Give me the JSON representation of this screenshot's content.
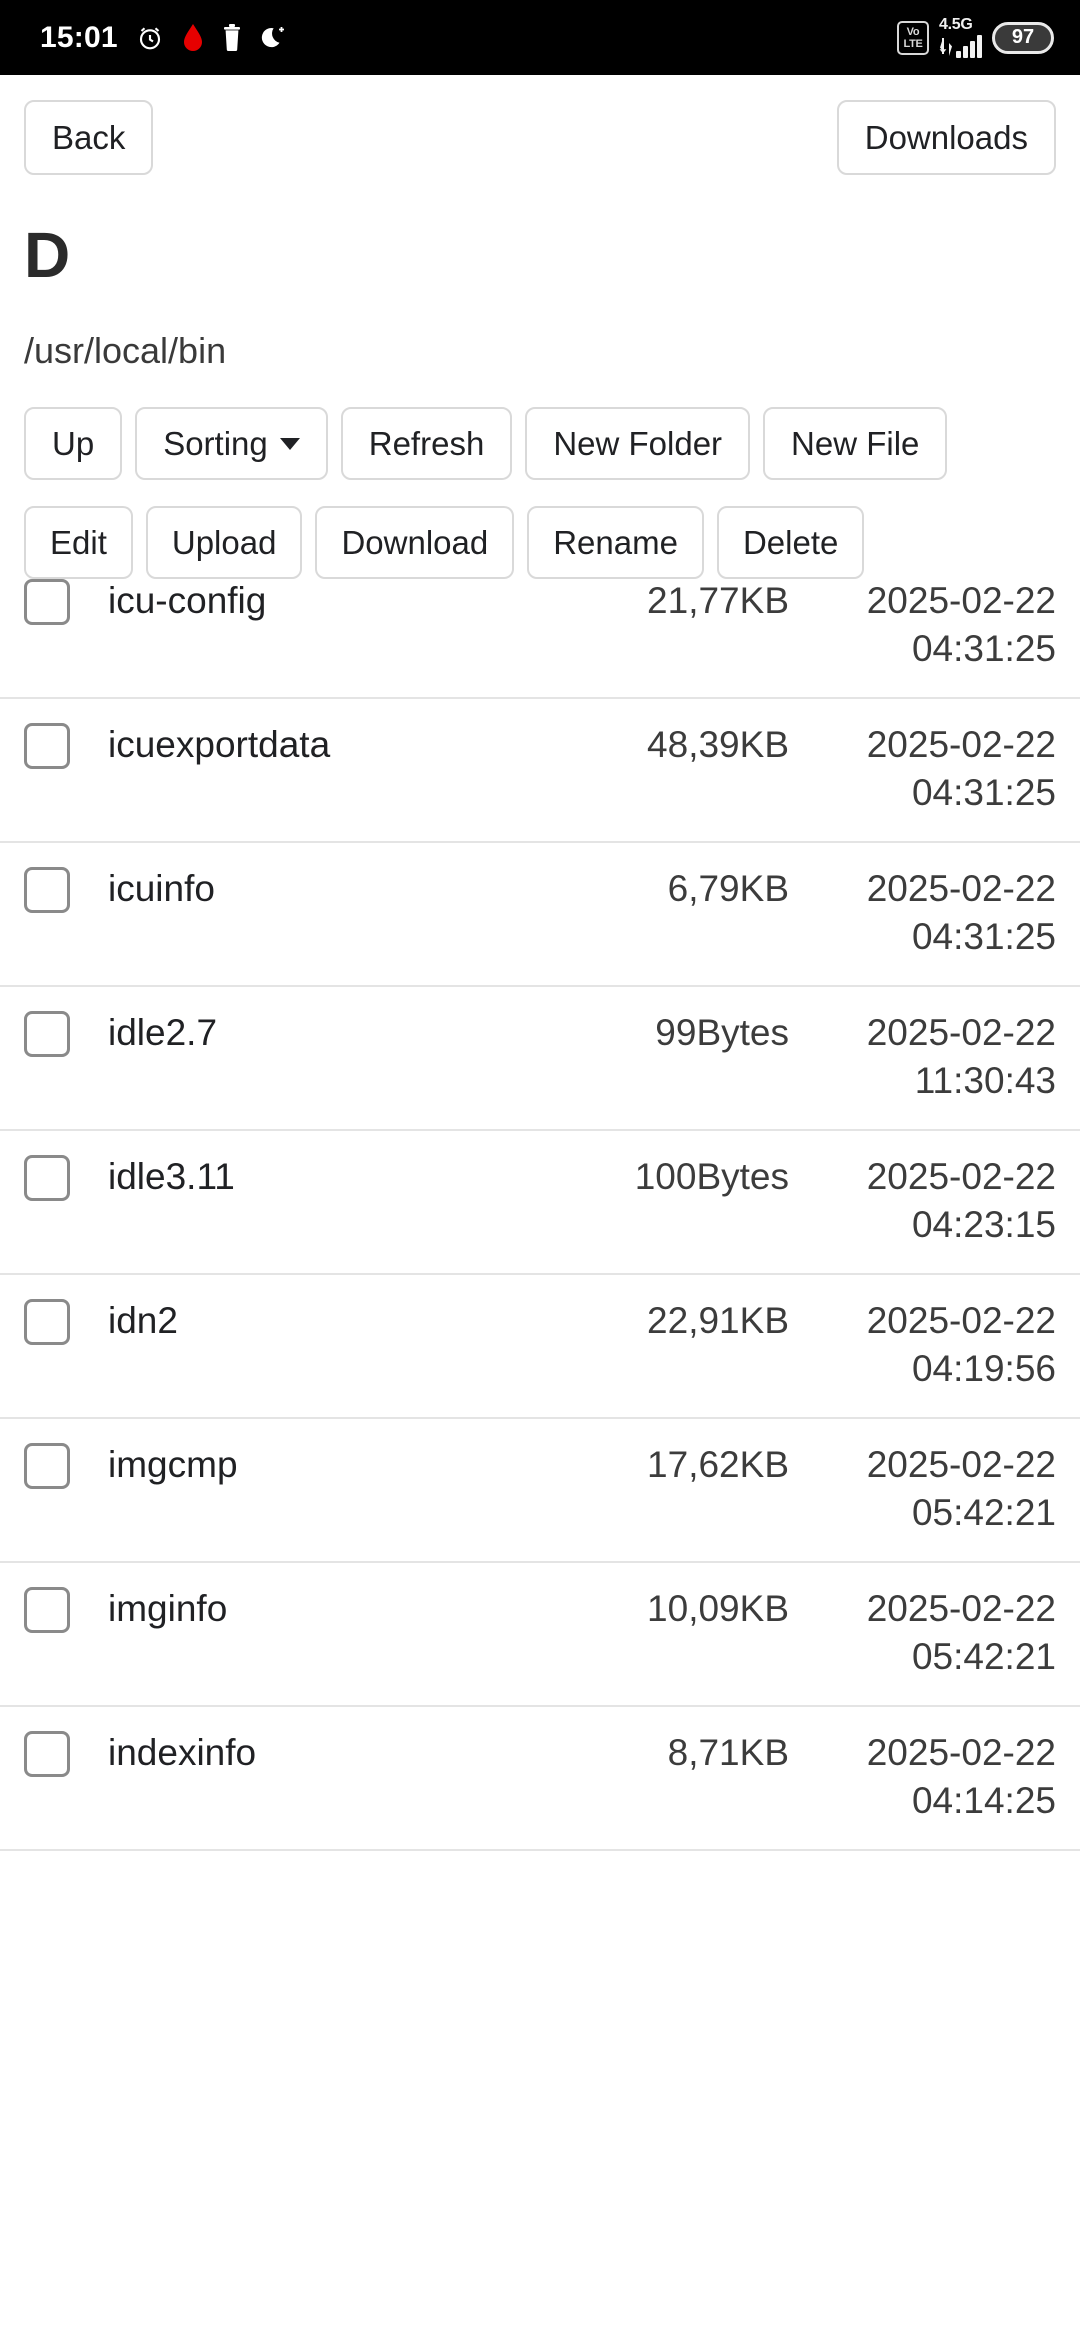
{
  "status_bar": {
    "time": "15:01",
    "icons": [
      "alarm-clock-icon",
      "recording-dot-icon",
      "trash-icon",
      "do-not-disturb-moon-icon"
    ],
    "volte_top": "Vo",
    "volte_bottom": "LTE",
    "network": "4.5G",
    "battery": "97"
  },
  "topbar": {
    "back_label": "Back",
    "downloads_label": "Downloads"
  },
  "header": {
    "title": "D",
    "path": "/usr/local/bin"
  },
  "toolbar": {
    "up_label": "Up",
    "sorting_label": "Sorting",
    "refresh_label": "Refresh",
    "new_folder_label": "New Folder",
    "new_file_label": "New File"
  },
  "actions": {
    "edit_label": "Edit",
    "upload_label": "Upload",
    "download_label": "Download",
    "rename_label": "Rename",
    "delete_label": "Delete"
  },
  "files": [
    {
      "name": "icu-config",
      "size": "21,77KB",
      "date": "2025-02-22",
      "time": "04:31:25"
    },
    {
      "name": "icuexportdata",
      "size": "48,39KB",
      "date": "2025-02-22",
      "time": "04:31:25"
    },
    {
      "name": "icuinfo",
      "size": "6,79KB",
      "date": "2025-02-22",
      "time": "04:31:25"
    },
    {
      "name": "idle2.7",
      "size": "99Bytes",
      "date": "2025-02-22",
      "time": "11:30:43"
    },
    {
      "name": "idle3.11",
      "size": "100Bytes",
      "date": "2025-02-22",
      "time": "04:23:15"
    },
    {
      "name": "idn2",
      "size": "22,91KB",
      "date": "2025-02-22",
      "time": "04:19:56"
    },
    {
      "name": "imgcmp",
      "size": "17,62KB",
      "date": "2025-02-22",
      "time": "05:42:21"
    },
    {
      "name": "imginfo",
      "size": "10,09KB",
      "date": "2025-02-22",
      "time": "05:42:21"
    },
    {
      "name": "indexinfo",
      "size": "8,71KB",
      "date": "2025-02-22",
      "time": "04:14:25"
    }
  ],
  "colors": {
    "border": "#d9d9d9",
    "row_divider": "#e4e4e4",
    "text": "#202124",
    "status_bar_bg": "#000000",
    "record_dot": "#e60000"
  }
}
